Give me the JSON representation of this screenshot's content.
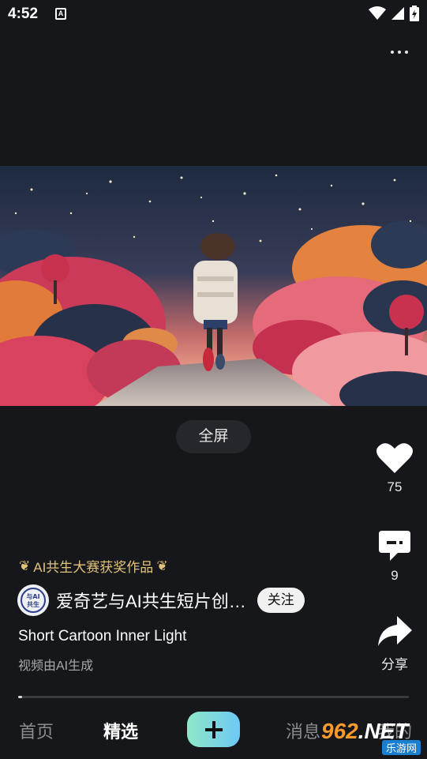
{
  "status_bar": {
    "time": "4:52",
    "a_icon": "A"
  },
  "video": {
    "fullscreen_label": "全屏"
  },
  "actions": {
    "like_count": "75",
    "comment_count": "9",
    "share_label": "分享"
  },
  "info": {
    "award": "AI共生大赛获奖作品",
    "avatar_text": "与AI共生",
    "author": "爱奇艺与AI共生短片创…",
    "follow_label": "关注",
    "title": "Short Cartoon Inner Light",
    "subtitle": "视频由AI生成",
    "progress": 0.01
  },
  "nav": {
    "home": "首页",
    "featured": "精选",
    "messages": "消息",
    "me": "我的"
  },
  "watermark": {
    "main_num": "962",
    "main_suffix": ".NET",
    "sub": "乐游网"
  },
  "colors": {
    "background": "#16171b",
    "award_gold": "#e2c27a",
    "add_button_gradient": [
      "#8fe7c6",
      "#6cc9f5"
    ]
  }
}
